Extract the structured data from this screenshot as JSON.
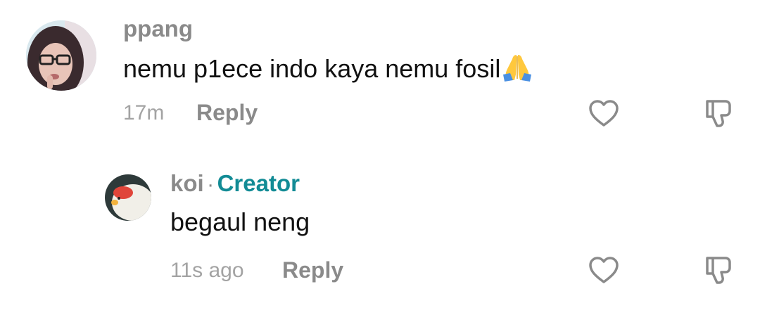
{
  "comments": [
    {
      "username": "ppang",
      "text": "nemu p1ece indo kaya nemu fosil",
      "emoji_icon": "folded-hands-emoji",
      "time": "17m",
      "reply_label": "Reply",
      "like_icon": "heart-icon",
      "dislike_icon": "thumbs-down-icon"
    },
    {
      "username": "koi",
      "separator": "·",
      "badge": "Creator",
      "badge_color": "#128b95",
      "text": "begaul neng",
      "time": "11s ago",
      "reply_label": "Reply",
      "like_icon": "heart-icon",
      "dislike_icon": "thumbs-down-icon"
    }
  ]
}
